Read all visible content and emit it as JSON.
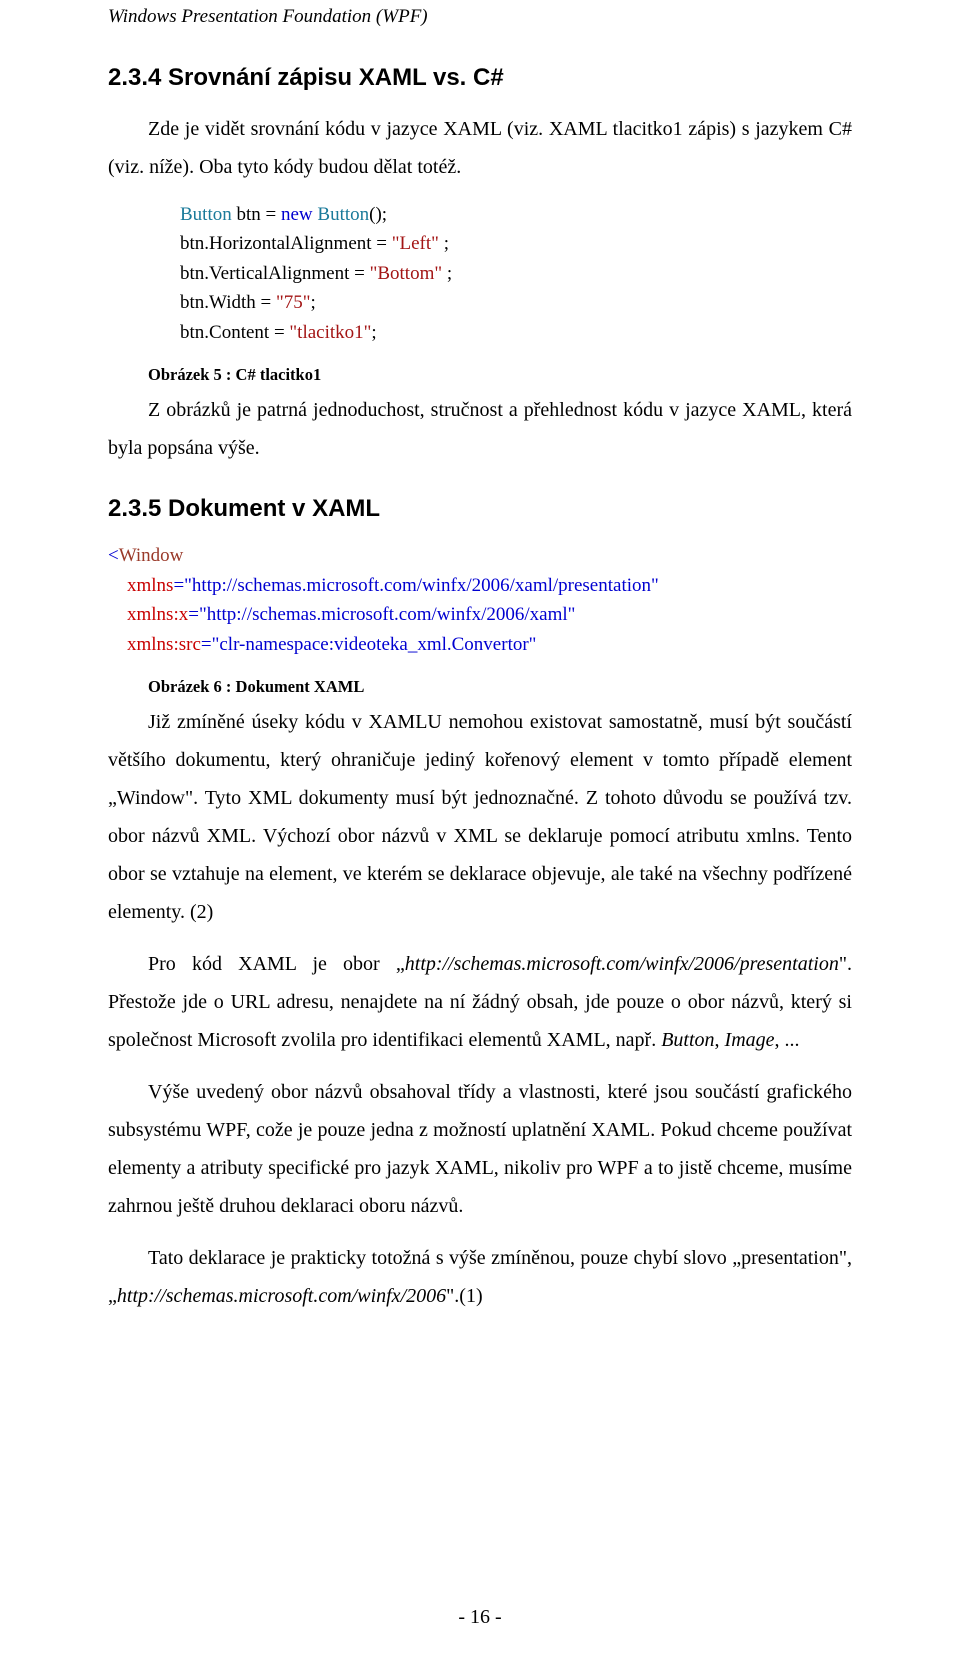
{
  "running_header": "Windows Presentation Foundation (WPF)",
  "section_234": {
    "heading": "2.3.4 Srovnání zápisu XAML vs. C#",
    "para1": "Zde je vidět srovnání kódu v jazyce XAML (viz. XAML tlacitko1 zápis) s jazykem C# (viz. níže). Oba tyto kódy budou dělat totéž.",
    "code_lines": [
      {
        "prefix": "",
        "typeA": "Button",
        "mid": " btn = ",
        "kw": "new",
        "mid2": " ",
        "typeB": "Button",
        "tail": "();"
      },
      {
        "plain": "btn.HorizontalAlignment = ",
        "str": "\"Left\"",
        "tail": " ;"
      },
      {
        "plain": "btn.VerticalAlignment = ",
        "str": "\"Bottom\"",
        "tail": " ;"
      },
      {
        "plain": "btn.Width = ",
        "str": "\"75\"",
        "tail": ";"
      },
      {
        "plain": "btn.Content = ",
        "str": "\"tlacitko1\"",
        "tail": ";"
      }
    ],
    "caption": "Obrázek 5 : C# tlacitko1",
    "para2": "Z obrázků je patrná jednoduchost, stručnost a přehlednost kódu v jazyce XAML, která byla popsána výše."
  },
  "section_235": {
    "heading": "2.3.5 Dokument v XAML",
    "xaml_lines": [
      {
        "tag_open": "<",
        "tag": "Window"
      },
      {
        "indent": "    ",
        "attr": "xmlns",
        "eq": "=",
        "val": "\"http://schemas.microsoft.com/winfx/2006/xaml/presentation\""
      },
      {
        "indent": "    ",
        "attr": "xmlns:x",
        "eq": "=",
        "val": "\"http://schemas.microsoft.com/winfx/2006/xaml\""
      },
      {
        "indent": "    ",
        "attr": "xmlns:src",
        "eq": "=",
        "val": "\"clr-namespace:videoteka_xml.Convertor\""
      }
    ],
    "caption": "Obrázek 6 : Dokument XAML",
    "para1_a": "Již zmíněné úseky kódu v XAMLU nemohou existovat samostatně, musí být součástí většího dokumentu, který ohraničuje jediný kořenový element v tomto případě element „Window\". Tyto XML dokumenty musí být jednoznačné. Z tohoto důvodu se používá tzv. obor názvů XML. Výchozí obor názvů v XML se deklaruje pomocí atributu xmlns. Tento obor se vztahuje na element, ve kterém se deklarace objevuje, ale také na všechny podřízené elementy. (2)",
    "para2_a": "Pro kód XAML je obor „",
    "para2_url": "http://schemas.microsoft.com/winfx/2006/presentation",
    "para2_b": "\". Přestože jde o URL adresu, nenajdete na ní žádný obsah, jde pouze o obor názvů, který si společnost Microsoft zvolila pro identifikaci elementů XAML, např. ",
    "para2_em1": "Button",
    "para2_c": ", ",
    "para2_em2": "Image",
    "para2_d": ", ...",
    "para3": "Výše uvedený obor názvů obsahoval třídy a vlastnosti, které jsou součástí grafického subsystému WPF, cože je pouze jedna z možností uplatnění XAML. Pokud chceme používat elementy a atributy specifické pro jazyk XAML, nikoliv pro WPF a to jistě chceme, musíme zahrnou ještě druhou deklaraci oboru názvů.",
    "para4_a": "Tato deklarace je prakticky totožná s výše zmíněnou, pouze chybí slovo „presentation\", „",
    "para4_url": "http://schemas.microsoft.com/winfx/2006",
    "para4_b": "\".(1)"
  },
  "page_number": "- 16 -"
}
